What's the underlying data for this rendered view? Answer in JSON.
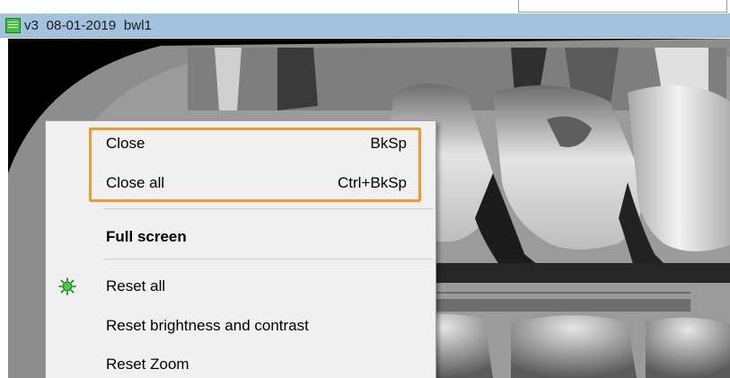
{
  "window": {
    "title": "v3  08-01-2019  bwl1",
    "icon": "image-list-icon",
    "accent": "#a3c2de"
  },
  "top_field": {
    "value": ""
  },
  "context_menu": {
    "highlight_color": "#ed9a2f",
    "items": [
      {
        "label": "Close",
        "shortcut": "BkSp",
        "bold": false,
        "icon": null
      },
      {
        "label": "Close all",
        "shortcut": "Ctrl+BkSp",
        "bold": false,
        "icon": null
      },
      {
        "label": "Full screen",
        "shortcut": "",
        "bold": true,
        "icon": null
      },
      {
        "label": "Reset all",
        "shortcut": "",
        "bold": false,
        "icon": "green-bulb-icon"
      },
      {
        "label": "Reset brightness and contrast",
        "shortcut": "",
        "bold": false,
        "icon": null
      },
      {
        "label": "Reset Zoom",
        "shortcut": "",
        "bold": false,
        "icon": null
      }
    ]
  }
}
